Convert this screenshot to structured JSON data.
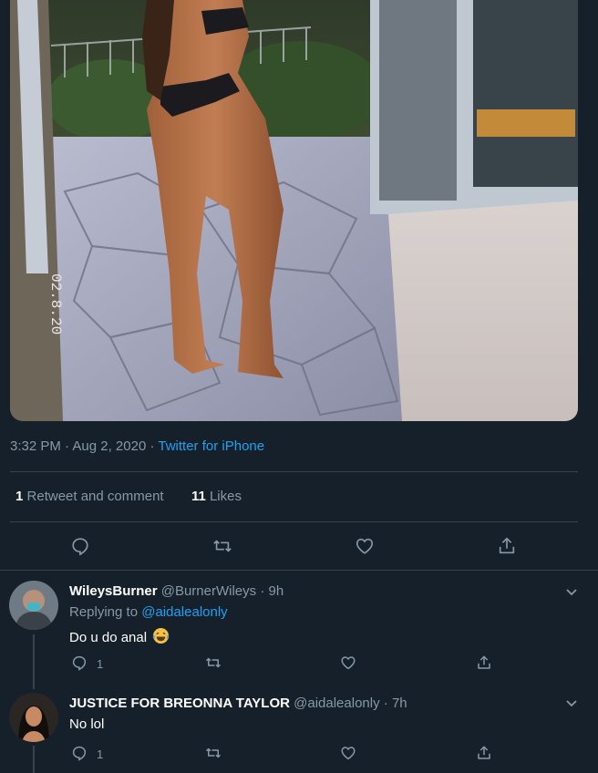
{
  "tweet": {
    "time": "3:32 PM",
    "separator": "·",
    "date": "Aug 2, 2020",
    "source": "Twitter for iPhone",
    "retweets_count": "1",
    "retweets_label": "Retweet and comment",
    "likes_count": "11",
    "likes_label": "Likes",
    "photo_stamp": "02.8.20",
    "actions": [
      "reply-icon",
      "retweet-icon",
      "like-icon",
      "share-icon"
    ]
  },
  "replies": [
    {
      "name": "WileysBurner",
      "handle": "@BurnerWileys",
      "separator": "·",
      "age": "9h",
      "replying_prefix": "Replying to",
      "replying_to": "@aidalealonly",
      "text": "Do u do anal",
      "emoji": "face-with-tears-of-joy",
      "reply_count": "1"
    },
    {
      "name": "JUSTICE FOR BREONNA TAYLOR",
      "handle": "@aidalealonly",
      "separator": "·",
      "age": "7h",
      "text": "No lol",
      "reply_count": "1"
    }
  ],
  "colors": {
    "background": "#15202b",
    "divider": "#38444d",
    "muted": "#8899a6",
    "accent": "#1da1f2",
    "text": "#ffffff"
  }
}
